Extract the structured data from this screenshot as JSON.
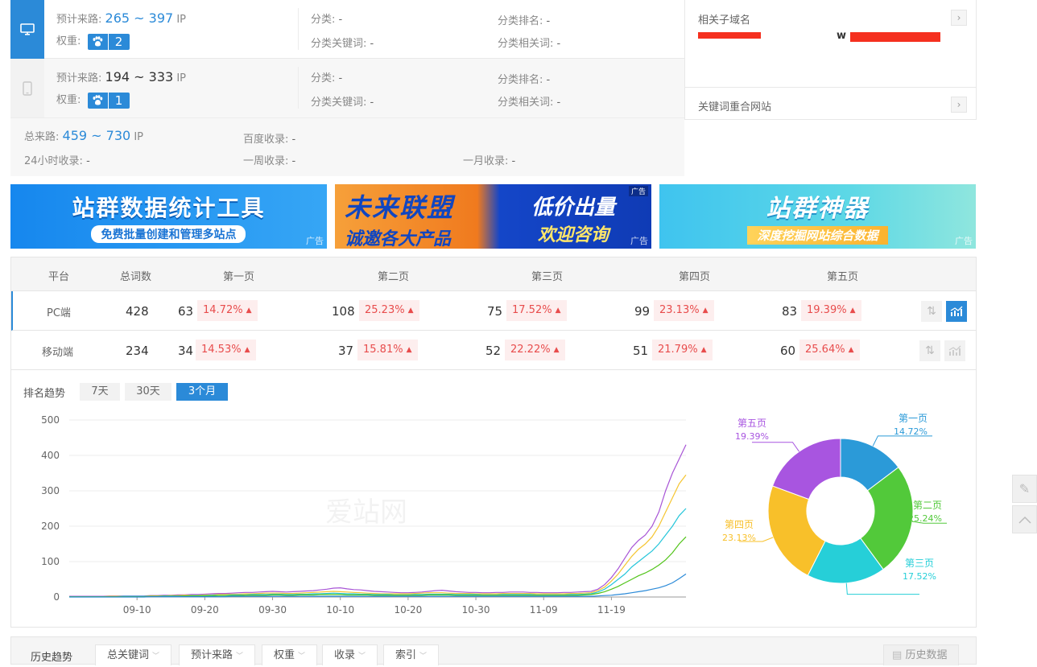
{
  "pc": {
    "traffic_label": "预计来路:",
    "traffic_min": "265",
    "traffic_sep": " ~ ",
    "traffic_max": "397",
    "traffic_unit": "IP",
    "weight_label": "权重:",
    "weight_value": "2",
    "category_label": "分类:",
    "category_value": "-",
    "category_kw_label": "分类关键词:",
    "category_kw_value": "-",
    "category_rank_label": "分类排名:",
    "category_rank_value": "-",
    "category_rel_label": "分类相关词:",
    "category_rel_value": "-"
  },
  "mobile": {
    "traffic_label": "预计来路:",
    "traffic_min": "194",
    "traffic_sep": " ~ ",
    "traffic_max": "333",
    "traffic_unit": "IP",
    "weight_label": "权重:",
    "weight_value": "1",
    "category_label": "分类:",
    "category_value": "-",
    "category_kw_label": "分类关键词:",
    "category_kw_value": "-",
    "category_rank_label": "分类排名:",
    "category_rank_value": "-",
    "category_rel_label": "分类相关词:",
    "category_rel_value": "-"
  },
  "totals": {
    "total_label": "总来路:",
    "total_min": "459",
    "total_sep": " ~ ",
    "total_max": "730",
    "total_unit": "IP",
    "baidu_index_label": "百度收录:",
    "baidu_index_value": "-",
    "day_index_label": "24小时收录:",
    "day_index_value": "-",
    "week_index_label": "一周收录:",
    "week_index_value": "-",
    "month_index_label": "一月收录:",
    "month_index_value": "-"
  },
  "side_panel": {
    "subdomain_title": "相关子域名",
    "overlap_title": "关键词重合网站",
    "chevron": "›",
    "partial_text": "w"
  },
  "ads": [
    {
      "line1": "站群数据统计工具",
      "line2": "免费批量创建和管理多站点",
      "tag": "广告",
      "bg": "#1e8ef0"
    },
    {
      "line1": "未来联盟",
      "line2": "诚邀各大产品",
      "line3": "低价出量",
      "line4": "欢迎咨询",
      "tag": "广告",
      "bg": "#f07a1e"
    },
    {
      "line1": "站群神器",
      "line2": "深度挖掘网站综合数据",
      "tag": "广告",
      "bg": "#3ac9df"
    }
  ],
  "rank_table": {
    "headers": [
      "平台",
      "总词数",
      "第一页",
      "第二页",
      "第三页",
      "第四页",
      "第五页"
    ],
    "rows": [
      {
        "platform": "PC端",
        "total": "428",
        "pages": [
          {
            "count": "63",
            "pct": "14.72%"
          },
          {
            "count": "108",
            "pct": "25.23%"
          },
          {
            "count": "75",
            "pct": "17.52%"
          },
          {
            "count": "99",
            "pct": "23.13%"
          },
          {
            "count": "83",
            "pct": "19.39%"
          }
        ]
      },
      {
        "platform": "移动端",
        "total": "234",
        "pages": [
          {
            "count": "34",
            "pct": "14.53%"
          },
          {
            "count": "37",
            "pct": "15.81%"
          },
          {
            "count": "52",
            "pct": "22.22%"
          },
          {
            "count": "51",
            "pct": "21.79%"
          },
          {
            "count": "60",
            "pct": "25.64%"
          }
        ]
      }
    ],
    "up_arrow": "▲"
  },
  "trend": {
    "title": "排名趋势",
    "ranges": [
      "7天",
      "30天",
      "3个月"
    ],
    "active_range": "3个月",
    "watermark": "爱站网"
  },
  "chart_data": [
    {
      "type": "line",
      "x_ticks": [
        "09-10",
        "09-20",
        "09-30",
        "10-10",
        "10-20",
        "10-30",
        "11-09",
        "11-19"
      ],
      "ylim": [
        0,
        500
      ],
      "y_ticks": [
        0,
        100,
        200,
        300,
        400,
        500
      ],
      "grid": true,
      "series": [
        {
          "color": "#a855d6",
          "values": [
            2,
            2,
            2,
            2,
            2,
            2,
            3,
            3,
            3,
            3,
            3,
            3,
            4,
            4,
            5,
            5,
            6,
            6,
            7,
            7,
            8,
            9,
            10,
            10,
            11,
            12,
            13,
            13,
            14,
            15,
            16,
            15,
            14,
            15,
            16,
            17,
            18,
            20,
            22,
            25,
            26,
            23,
            21,
            20,
            18,
            16,
            15,
            14,
            13,
            12,
            12,
            13,
            14,
            16,
            18,
            19,
            17,
            15,
            14,
            13,
            13,
            12,
            12,
            13,
            13,
            14,
            14,
            14,
            13,
            13,
            12,
            12,
            12,
            13,
            13,
            14,
            15,
            16,
            22,
            35,
            55,
            80,
            110,
            140,
            160,
            175,
            200,
            240,
            300,
            350,
            390,
            430
          ]
        },
        {
          "color": "#f5c531",
          "values": [
            1,
            1,
            1,
            1,
            1,
            1,
            2,
            2,
            2,
            2,
            2,
            2,
            3,
            3,
            3,
            4,
            4,
            5,
            5,
            5,
            6,
            6,
            7,
            7,
            8,
            8,
            9,
            9,
            10,
            11,
            11,
            11,
            10,
            10,
            11,
            12,
            13,
            14,
            15,
            16,
            15,
            14,
            13,
            12,
            11,
            10,
            9,
            9,
            9,
            9,
            9,
            10,
            11,
            12,
            12,
            12,
            11,
            10,
            10,
            10,
            9,
            9,
            9,
            9,
            10,
            10,
            10,
            10,
            10,
            9,
            9,
            9,
            9,
            9,
            10,
            10,
            11,
            12,
            18,
            28,
            45,
            65,
            90,
            115,
            135,
            150,
            170,
            200,
            240,
            280,
            320,
            345
          ]
        },
        {
          "color": "#26c6da",
          "values": [
            1,
            1,
            1,
            1,
            1,
            1,
            1,
            1,
            2,
            2,
            2,
            2,
            2,
            2,
            3,
            3,
            3,
            3,
            4,
            4,
            4,
            5,
            5,
            5,
            6,
            6,
            6,
            7,
            7,
            7,
            8,
            8,
            7,
            7,
            8,
            8,
            9,
            9,
            10,
            11,
            10,
            9,
            9,
            8,
            8,
            7,
            7,
            7,
            6,
            6,
            6,
            7,
            7,
            8,
            8,
            8,
            8,
            7,
            7,
            7,
            7,
            6,
            6,
            6,
            7,
            7,
            7,
            7,
            7,
            6,
            6,
            6,
            6,
            6,
            7,
            7,
            8,
            9,
            14,
            22,
            35,
            50,
            65,
            85,
            100,
            115,
            130,
            150,
            175,
            200,
            230,
            250
          ]
        },
        {
          "color": "#52c41a",
          "values": [
            1,
            1,
            1,
            1,
            1,
            1,
            1,
            1,
            1,
            1,
            1,
            1,
            2,
            2,
            2,
            2,
            2,
            3,
            3,
            3,
            3,
            3,
            4,
            4,
            4,
            4,
            5,
            5,
            5,
            5,
            6,
            6,
            5,
            5,
            6,
            6,
            6,
            7,
            7,
            7,
            7,
            6,
            6,
            6,
            6,
            5,
            5,
            5,
            5,
            5,
            5,
            5,
            5,
            6,
            6,
            6,
            6,
            5,
            5,
            5,
            5,
            5,
            5,
            5,
            5,
            5,
            5,
            5,
            5,
            5,
            5,
            5,
            5,
            5,
            5,
            5,
            6,
            7,
            10,
            15,
            22,
            30,
            40,
            50,
            60,
            68,
            78,
            90,
            105,
            125,
            150,
            170
          ]
        },
        {
          "color": "#2b8ad8",
          "values": [
            0,
            0,
            0,
            0,
            0,
            0,
            0,
            0,
            0,
            0,
            0,
            0,
            1,
            1,
            1,
            1,
            1,
            1,
            1,
            1,
            1,
            1,
            1,
            1,
            2,
            2,
            2,
            2,
            2,
            2,
            2,
            2,
            2,
            2,
            2,
            2,
            2,
            2,
            2,
            2,
            2,
            2,
            2,
            2,
            2,
            2,
            2,
            2,
            2,
            2,
            2,
            2,
            2,
            2,
            2,
            2,
            2,
            2,
            2,
            2,
            2,
            2,
            2,
            2,
            2,
            2,
            2,
            2,
            2,
            2,
            2,
            2,
            2,
            2,
            2,
            2,
            2,
            2,
            3,
            4,
            5,
            7,
            9,
            12,
            15,
            18,
            22,
            26,
            32,
            40,
            52,
            65
          ]
        }
      ]
    },
    {
      "type": "pie",
      "donut": true,
      "slices": [
        {
          "name": "第一页",
          "pct": "14.72%",
          "value": 14.72,
          "color": "#2b9ad8"
        },
        {
          "name": "第二页",
          "pct": "25.24%",
          "value": 25.24,
          "color": "#52c93a"
        },
        {
          "name": "第三页",
          "pct": "17.52%",
          "value": 17.52,
          "color": "#26cfd8"
        },
        {
          "name": "第四页",
          "pct": "23.13%",
          "value": 23.13,
          "color": "#f8c02a"
        },
        {
          "name": "第五页",
          "pct": "19.39%",
          "value": 19.39,
          "color": "#a855e0"
        }
      ]
    }
  ],
  "bottom_bar": {
    "title": "历史趋势",
    "dropdowns": [
      "总关键词",
      "预计来路",
      "权重",
      "收录",
      "索引"
    ],
    "history_label": "历史数据",
    "caret": "﹀"
  }
}
